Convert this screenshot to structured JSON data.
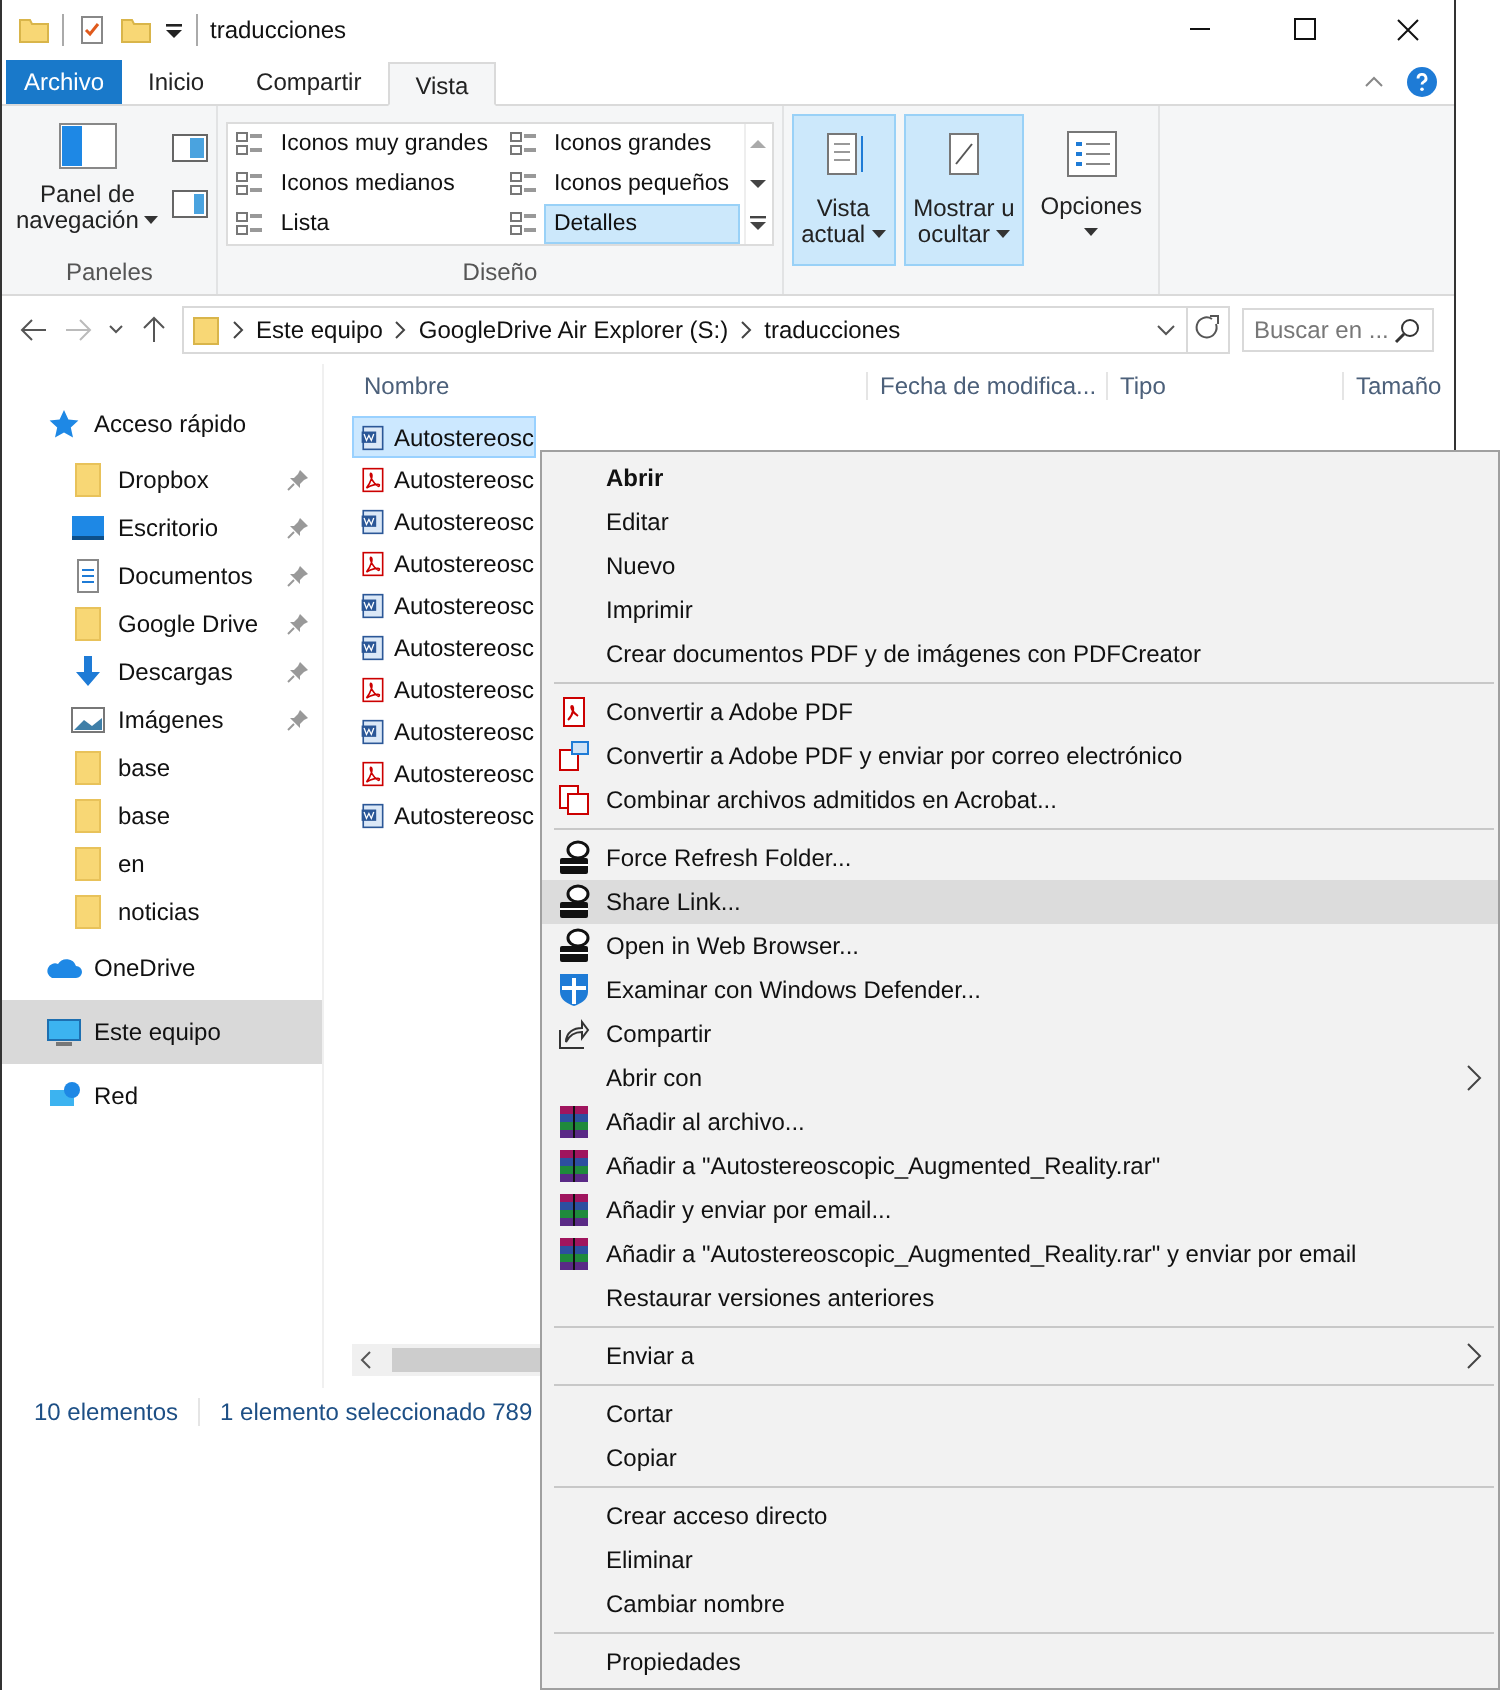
{
  "window": {
    "title": "traducciones"
  },
  "ribbon_tabs": [
    {
      "label": "Archivo",
      "kind": "file",
      "selected": false
    },
    {
      "label": "Inicio",
      "kind": "tab",
      "selected": false
    },
    {
      "label": "Compartir",
      "kind": "tab",
      "selected": false
    },
    {
      "label": "Vista",
      "kind": "tab",
      "selected": true
    }
  ],
  "ribbon": {
    "panes": {
      "nav_label": "Panel de",
      "nav_label2": "navegación",
      "group": "Paneles"
    },
    "layouts": [
      {
        "label": "Iconos muy grandes",
        "selected": false
      },
      {
        "label": "Iconos grandes",
        "selected": false
      },
      {
        "label": "Iconos medianos",
        "selected": false
      },
      {
        "label": "Iconos pequeños",
        "selected": false
      },
      {
        "label": "Lista",
        "selected": false
      },
      {
        "label": "Detalles",
        "selected": true
      }
    ],
    "layout_group": "Diseño",
    "big_buttons": [
      {
        "line1": "Vista",
        "line2": "actual",
        "kind": "sort",
        "selected": true
      },
      {
        "line1": "Mostrar u",
        "line2": "ocultar",
        "kind": "show",
        "selected": true
      },
      {
        "line1": "Opciones",
        "kind": "options",
        "selected": false
      }
    ]
  },
  "address": {
    "crumbs": [
      "Este equipo",
      "GoogleDrive Air Explorer (S:)",
      "traducciones"
    ],
    "search_placeholder": "Buscar en ..."
  },
  "sidebar": [
    {
      "label": "Acceso rápido",
      "kind": "star",
      "selected": false,
      "children": [
        {
          "label": "Dropbox",
          "kind": "folder",
          "pinned": true,
          "selected": false
        },
        {
          "label": "Escritorio",
          "kind": "desktop",
          "pinned": true,
          "selected": false
        },
        {
          "label": "Documentos",
          "kind": "docs",
          "pinned": true,
          "selected": false
        },
        {
          "label": "Google Drive",
          "kind": "folder",
          "pinned": true,
          "selected": false
        },
        {
          "label": "Descargas",
          "kind": "download",
          "pinned": true,
          "selected": false
        },
        {
          "label": "Imágenes",
          "kind": "images",
          "pinned": true,
          "selected": false
        },
        {
          "label": "base",
          "kind": "folder",
          "pinned": false,
          "selected": false
        },
        {
          "label": "base",
          "kind": "folder",
          "pinned": false,
          "selected": false
        },
        {
          "label": "en",
          "kind": "folder",
          "pinned": false,
          "selected": false
        },
        {
          "label": "noticias",
          "kind": "folder",
          "pinned": false,
          "selected": false
        }
      ]
    },
    {
      "label": "OneDrive",
      "kind": "cloud",
      "selected": false
    },
    {
      "label": "Este equipo",
      "kind": "pc",
      "selected": true
    },
    {
      "label": "Red",
      "kind": "network",
      "selected": false
    }
  ],
  "table": {
    "columns": [
      "Nombre",
      "Fecha de modifica...",
      "Tipo",
      "Tamaño"
    ],
    "rows": [
      {
        "name": "Autostereosc",
        "kind": "word",
        "selected": true
      },
      {
        "name": "Autostereosc",
        "kind": "pdf",
        "selected": false
      },
      {
        "name": "Autostereosc",
        "kind": "word",
        "selected": false
      },
      {
        "name": "Autostereosc",
        "kind": "pdf",
        "selected": false
      },
      {
        "name": "Autostereosc",
        "kind": "word",
        "selected": false
      },
      {
        "name": "Autostereosc",
        "kind": "word",
        "selected": false
      },
      {
        "name": "Autostereosc",
        "kind": "pdf",
        "selected": false
      },
      {
        "name": "Autostereosc",
        "kind": "word",
        "selected": false
      },
      {
        "name": "Autostereosc",
        "kind": "pdf",
        "selected": false
      },
      {
        "name": "Autostereosc",
        "kind": "word",
        "selected": false
      }
    ]
  },
  "status_bar": {
    "count": "10 elementos",
    "selection": "1 elemento seleccionado  789"
  },
  "context_menu": [
    {
      "items": [
        {
          "label": "Abrir",
          "kind": "plain",
          "bold": true,
          "submenu": false,
          "selected": false
        },
        {
          "label": "Editar",
          "kind": "plain",
          "bold": false,
          "submenu": false,
          "selected": false
        },
        {
          "label": "Nuevo",
          "kind": "plain",
          "bold": false,
          "submenu": false,
          "selected": false
        },
        {
          "label": "Imprimir",
          "kind": "plain",
          "bold": false,
          "submenu": false,
          "selected": false
        },
        {
          "label": "Crear documentos PDF y de imágenes con PDFCreator",
          "kind": "plain",
          "bold": false,
          "submenu": false,
          "selected": false
        }
      ]
    },
    {
      "items": [
        {
          "label": "Convertir a Adobe PDF",
          "kind": "pdf",
          "bold": false,
          "submenu": false,
          "selected": false
        },
        {
          "label": "Convertir a Adobe PDF y enviar por correo electrónico",
          "kind": "pdf-mail",
          "bold": false,
          "submenu": false,
          "selected": false
        },
        {
          "label": "Combinar archivos admitidos en Acrobat...",
          "kind": "pdf-combine",
          "bold": false,
          "submenu": false,
          "selected": false
        }
      ]
    },
    {
      "items": [
        {
          "label": "Force Refresh Folder...",
          "kind": "drive",
          "bold": false,
          "submenu": false,
          "selected": false
        },
        {
          "label": "Share Link...",
          "kind": "drive",
          "bold": false,
          "submenu": false,
          "selected": true
        },
        {
          "label": "Open in Web Browser...",
          "kind": "drive",
          "bold": false,
          "submenu": false,
          "selected": false
        },
        {
          "label": "Examinar con Windows Defender...",
          "kind": "shield",
          "bold": false,
          "submenu": false,
          "selected": false
        },
        {
          "label": "Compartir",
          "kind": "share",
          "bold": false,
          "submenu": false,
          "selected": false
        },
        {
          "label": "Abrir con",
          "kind": "plain",
          "bold": false,
          "submenu": true,
          "selected": false
        },
        {
          "label": "Añadir al archivo...",
          "kind": "rar",
          "bold": false,
          "submenu": false,
          "selected": false
        },
        {
          "label": "Añadir a \"Autostereoscopic_Augmented_Reality.rar\"",
          "kind": "rar",
          "bold": false,
          "submenu": false,
          "selected": false
        },
        {
          "label": "Añadir y enviar por email...",
          "kind": "rar",
          "bold": false,
          "submenu": false,
          "selected": false
        },
        {
          "label": "Añadir a \"Autostereoscopic_Augmented_Reality.rar\" y enviar por email",
          "kind": "rar",
          "bold": false,
          "submenu": false,
          "selected": false
        },
        {
          "label": "Restaurar versiones anteriores",
          "kind": "plain",
          "bold": false,
          "submenu": false,
          "selected": false
        }
      ]
    },
    {
      "items": [
        {
          "label": "Enviar a",
          "kind": "plain",
          "bold": false,
          "submenu": true,
          "selected": false
        }
      ]
    },
    {
      "items": [
        {
          "label": "Cortar",
          "kind": "plain",
          "bold": false,
          "submenu": false,
          "selected": false
        },
        {
          "label": "Copiar",
          "kind": "plain",
          "bold": false,
          "submenu": false,
          "selected": false
        }
      ]
    },
    {
      "items": [
        {
          "label": "Crear acceso directo",
          "kind": "plain",
          "bold": false,
          "submenu": false,
          "selected": false
        },
        {
          "label": "Eliminar",
          "kind": "plain",
          "bold": false,
          "submenu": false,
          "selected": false
        },
        {
          "label": "Cambiar nombre",
          "kind": "plain",
          "bold": false,
          "submenu": false,
          "selected": false
        }
      ]
    },
    {
      "items": [
        {
          "label": "Propiedades",
          "kind": "plain",
          "bold": false,
          "submenu": false,
          "selected": false
        }
      ]
    }
  ]
}
